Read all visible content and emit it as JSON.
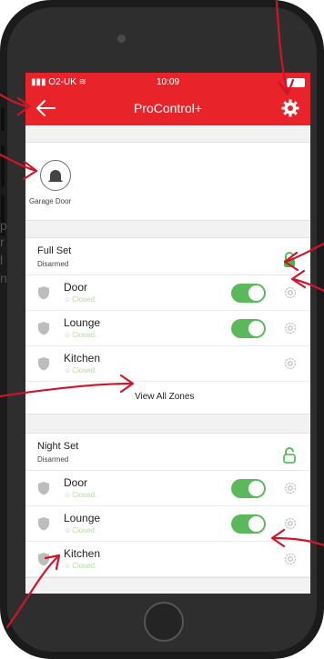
{
  "status_bar": {
    "carrier": "O2-UK",
    "time": "10:09"
  },
  "nav": {
    "title": "ProControl+",
    "back_icon": "back-arrow-icon",
    "settings_icon": "gear-icon"
  },
  "garage": {
    "label": "Garage Door",
    "icon": "garage-door-icon"
  },
  "full_set": {
    "name": "Full Set",
    "status": "Disarmed",
    "lock_icon": "unlocked-padlock-icon",
    "zones": [
      {
        "name": "Door",
        "state": "Closed.",
        "toggle_on": true
      },
      {
        "name": "Lounge",
        "state": "Closed.",
        "toggle_on": true
      },
      {
        "name": "Kitchen",
        "state": "Closed.",
        "toggle_on": false
      }
    ],
    "view_all": "View All Zones"
  },
  "night_set": {
    "name": "Night Set",
    "status": "Disarmed",
    "lock_icon": "unlocked-padlock-icon",
    "zones": [
      {
        "name": "Door",
        "state": "Closed.",
        "toggle_on": true
      },
      {
        "name": "Lounge",
        "state": "Closed.",
        "toggle_on": true
      },
      {
        "name": "Kitchen",
        "state": "Closed.",
        "toggle_on": false
      }
    ]
  },
  "side_text_fragments": [
    "p",
    "r",
    "l",
    "n"
  ],
  "colors": {
    "accent_red": "#e8232a",
    "toggle_green": "#5cb85c",
    "lock_green": "#43b84a",
    "annotation_red": "#d0142a"
  }
}
